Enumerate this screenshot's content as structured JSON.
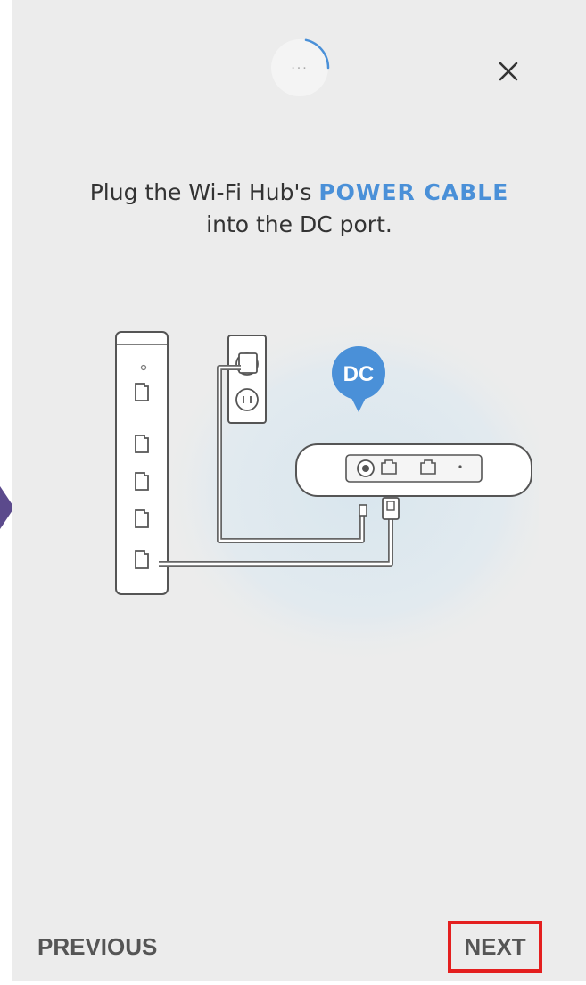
{
  "instruction": {
    "line1_prefix": "Plug the Wi-Fi Hub's ",
    "line1_highlight": "POWER CABLE",
    "line2": "into the DC port."
  },
  "progress": {
    "dots": "..."
  },
  "illustration": {
    "badge_label": "DC"
  },
  "footer": {
    "previous_label": "PREVIOUS",
    "next_label": "NEXT"
  },
  "colors": {
    "highlight": "#4a90d8",
    "annotation_box": "#e41f1f",
    "side_arrow": "#5b4a8c",
    "background": "#ececec"
  },
  "icons": {
    "close": "close-icon",
    "progress": "progress-spinner-icon",
    "side_arrow": "side-arrow-icon"
  }
}
